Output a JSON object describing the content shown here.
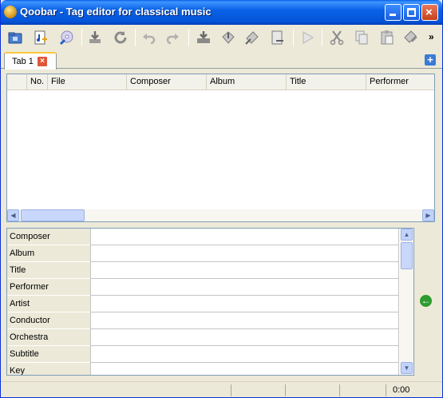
{
  "window": {
    "title": "Qoobar - Tag editor for classical music"
  },
  "toolbar": {
    "buttons": [
      {
        "icon": "open-folder-icon",
        "label": "Open folder"
      },
      {
        "icon": "add-files-icon",
        "label": "Add files"
      },
      {
        "icon": "cd-icon",
        "label": "Read CD"
      },
      {
        "icon": "download-icon",
        "label": "Import"
      },
      {
        "icon": "refresh-icon",
        "label": "Reload"
      },
      {
        "icon": "undo-icon",
        "label": "Undo"
      },
      {
        "icon": "redo-icon",
        "label": "Redo"
      },
      {
        "icon": "save-icon",
        "label": "Save"
      },
      {
        "icon": "tag-import-icon",
        "label": "Import tags"
      },
      {
        "icon": "tag-tools-icon",
        "label": "Tools"
      },
      {
        "icon": "rename-icon",
        "label": "Rename"
      },
      {
        "icon": "play-icon",
        "label": "Play"
      },
      {
        "icon": "cut-icon",
        "label": "Cut"
      },
      {
        "icon": "copy-icon",
        "label": "Copy"
      },
      {
        "icon": "paste-icon",
        "label": "Paste"
      },
      {
        "icon": "clear-tags-icon",
        "label": "Remove tags"
      }
    ],
    "more_label": "»"
  },
  "tabs": [
    {
      "label": "Tab 1",
      "close_label": "×"
    }
  ],
  "add_tab_label": "+",
  "tracklist": {
    "columns": [
      "No.",
      "File",
      "Composer",
      "Album",
      "Title",
      "Performer"
    ],
    "rows": []
  },
  "tags": {
    "fields": [
      {
        "label": "Composer",
        "value": ""
      },
      {
        "label": "Album",
        "value": ""
      },
      {
        "label": "Title",
        "value": ""
      },
      {
        "label": "Performer",
        "value": ""
      },
      {
        "label": "Artist",
        "value": ""
      },
      {
        "label": "Conductor",
        "value": ""
      },
      {
        "label": "Orchestra",
        "value": ""
      },
      {
        "label": "Subtitle",
        "value": ""
      },
      {
        "label": "Key",
        "value": ""
      }
    ]
  },
  "status": {
    "time": "0:00"
  },
  "colors": {
    "titlebar": "#0a5fe8",
    "tab_accent": "#ffc83c",
    "panel": "#ece9d8"
  }
}
